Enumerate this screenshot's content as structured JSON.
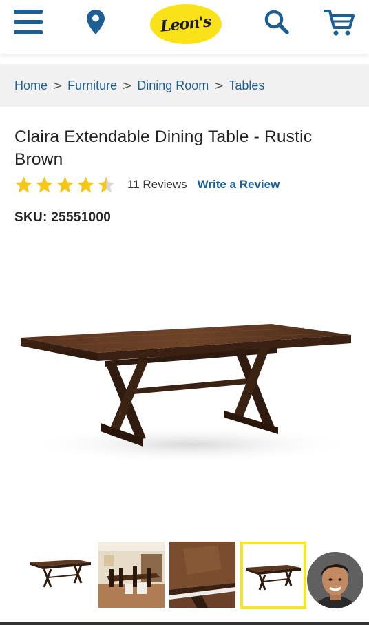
{
  "header": {
    "logo_text": "Leon's",
    "brand_color": "#f9e21a",
    "accent_color": "#1d5f95",
    "icons": [
      "menu-icon",
      "location-icon",
      "search-icon",
      "cart-icon"
    ]
  },
  "breadcrumb": {
    "items": [
      {
        "label": "Home"
      },
      {
        "label": "Furniture"
      },
      {
        "label": "Dining Room"
      },
      {
        "label": "Tables"
      }
    ],
    "separator": ">"
  },
  "product": {
    "title": "Claira Extendable Dining Table - Rustic Brown",
    "rating": 4.5,
    "rating_max": 5,
    "reviews_count": "11 Reviews",
    "write_review": "Write a Review",
    "sku": "SKU: 25551000"
  },
  "gallery": {
    "thumbnails": [
      {
        "name": "table-front",
        "active": false
      },
      {
        "name": "dining-room-scene",
        "active": false
      },
      {
        "name": "table-top-closeup",
        "active": false
      },
      {
        "name": "table-angle",
        "active": true
      }
    ],
    "active_color": "#f6e81c"
  }
}
